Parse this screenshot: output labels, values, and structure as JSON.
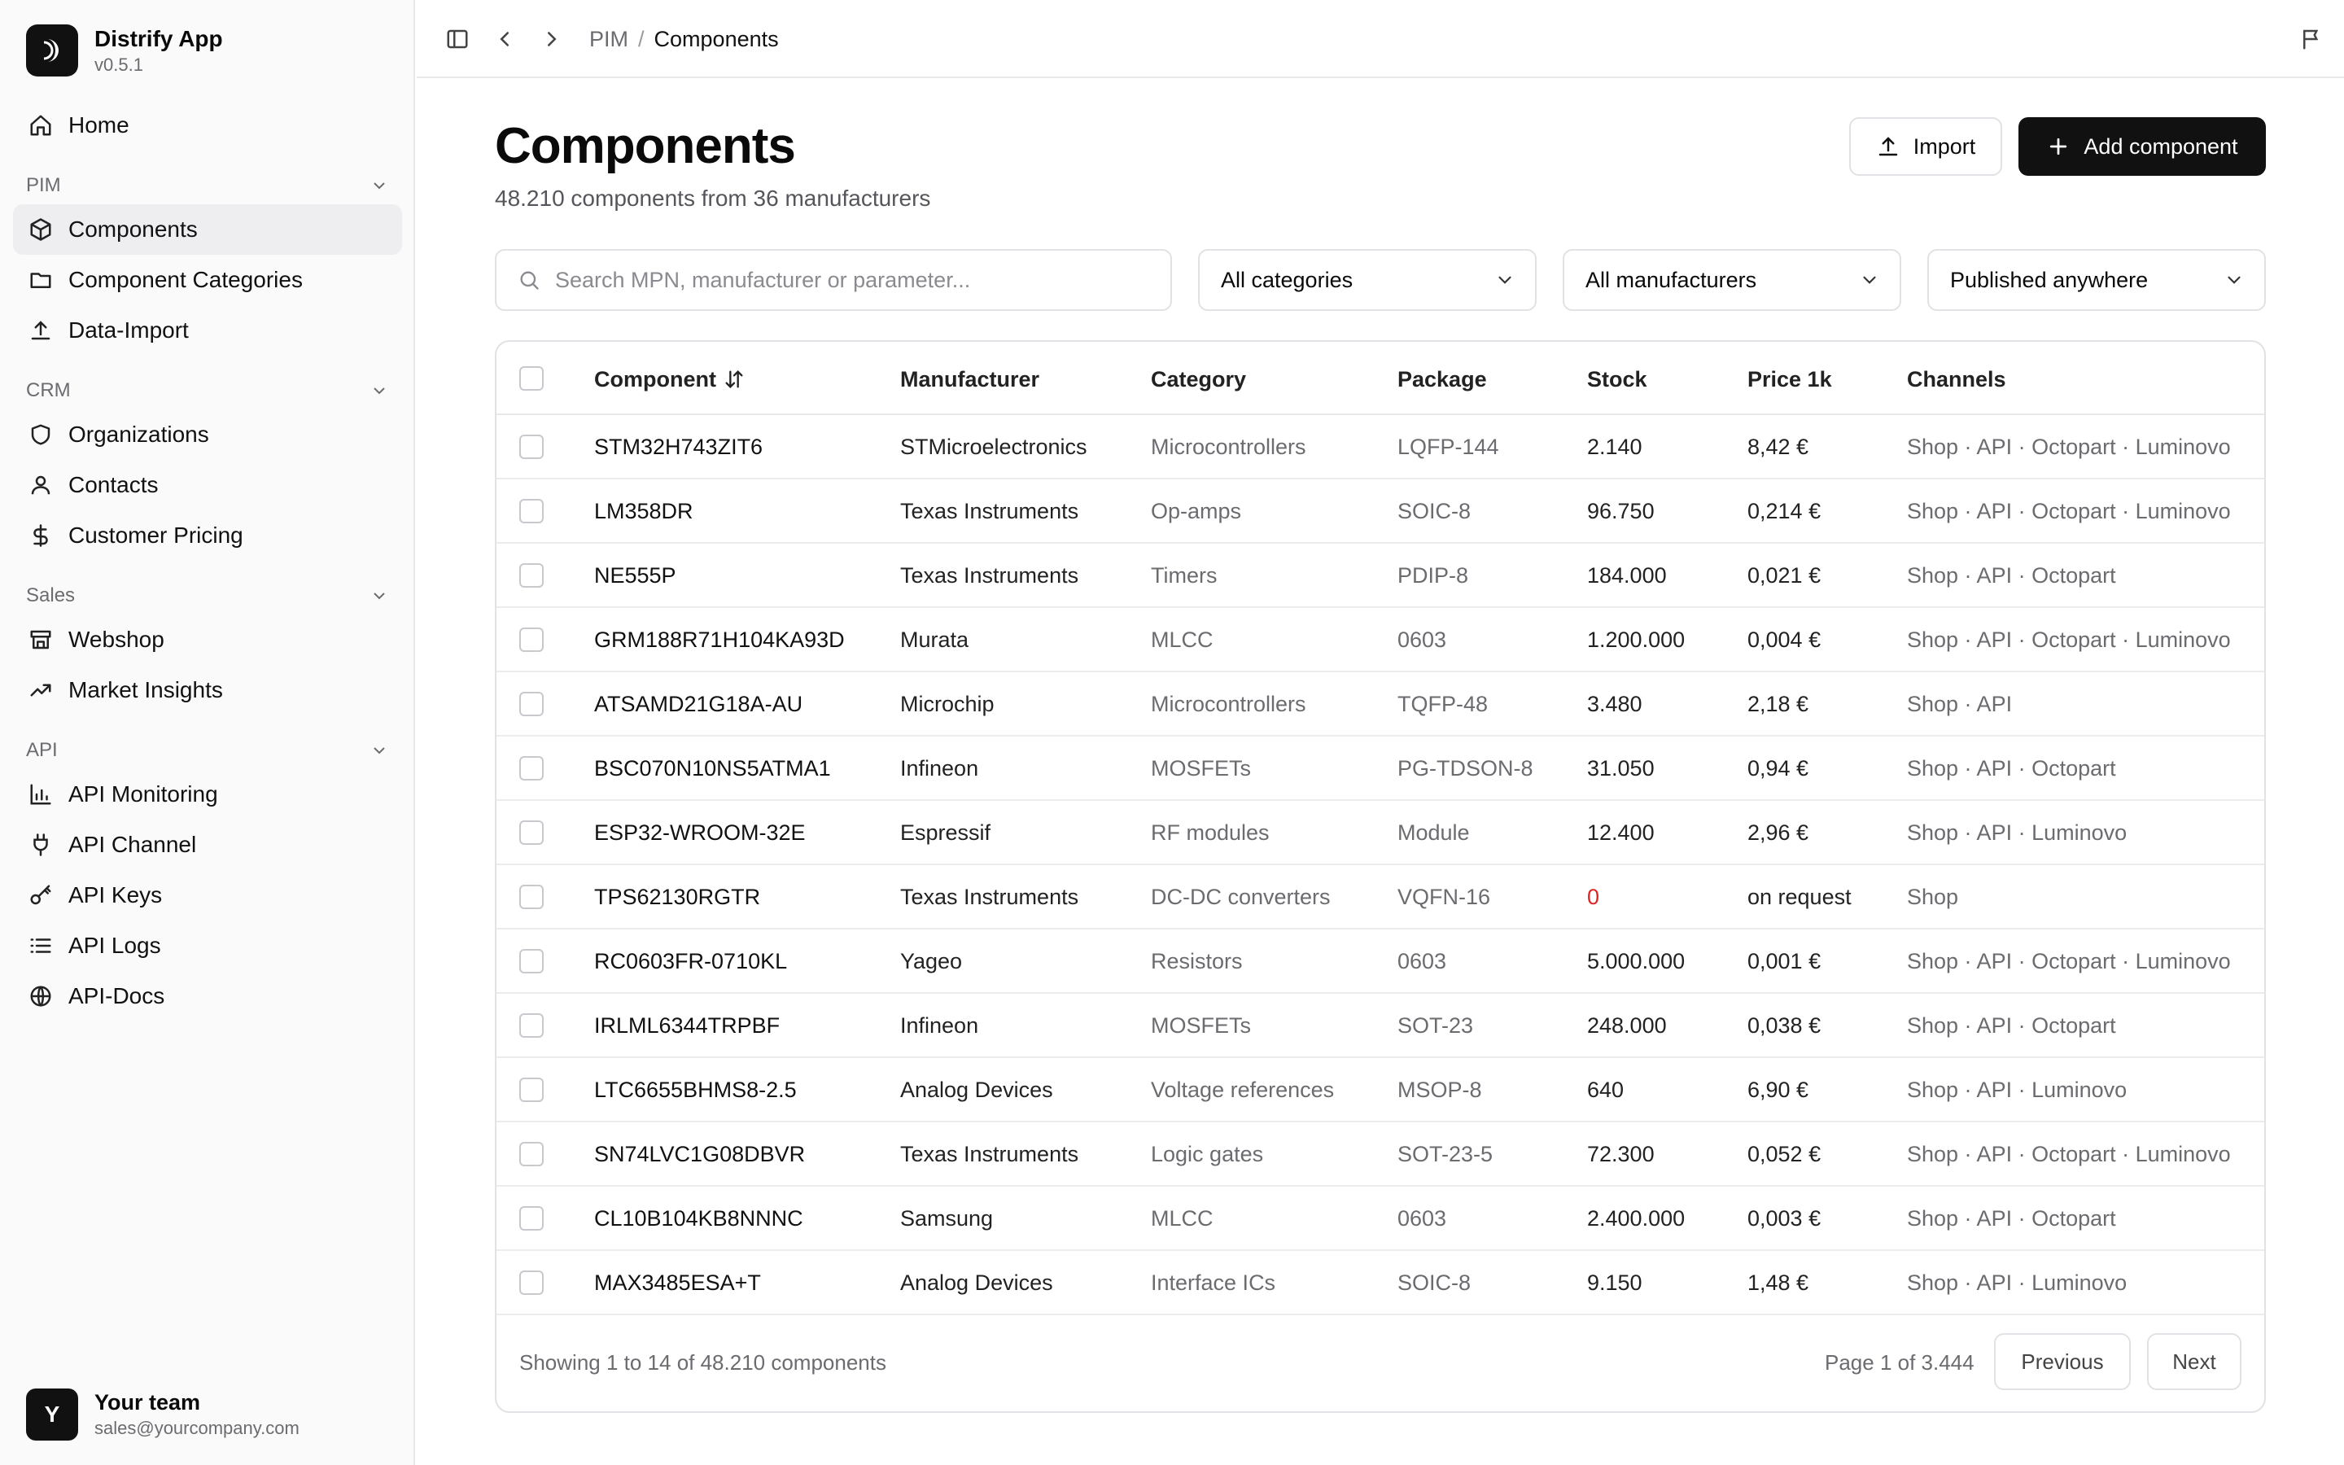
{
  "app": {
    "name": "Distrify App",
    "version": "v0.5.1"
  },
  "sidebar": {
    "home": "Home",
    "sections": [
      {
        "title": "PIM",
        "items": [
          "Components",
          "Component Categories",
          "Data-Import"
        ]
      },
      {
        "title": "CRM",
        "items": [
          "Organizations",
          "Contacts",
          "Customer Pricing"
        ]
      },
      {
        "title": "Sales",
        "items": [
          "Webshop",
          "Market Insights"
        ]
      },
      {
        "title": "API",
        "items": [
          "API Monitoring",
          "API Channel",
          "API Keys",
          "API Logs",
          "API-Docs"
        ]
      }
    ],
    "active_item": "Components",
    "user": {
      "initial": "Y",
      "name": "Your team",
      "email": "sales@yourcompany.com"
    }
  },
  "breadcrumb": {
    "parent": "PIM",
    "separator": "/",
    "current": "Components"
  },
  "header": {
    "title": "Components",
    "subtitle": "48.210 components from 36 manufacturers",
    "import_label": "Import",
    "add_label": "Add component"
  },
  "filters": {
    "search_placeholder": "Search MPN, manufacturer or parameter...",
    "category": "All categories",
    "manufacturer": "All manufacturers",
    "channel": "Published anywhere"
  },
  "table": {
    "columns": [
      "Component",
      "Manufacturer",
      "Category",
      "Package",
      "Stock",
      "Price 1k",
      "Channels"
    ],
    "rows": [
      [
        "STM32H743ZIT6",
        "STMicroelectronics",
        "Microcontrollers",
        "LQFP-144",
        "2.140",
        "8,42 €",
        "Shop · API · Octopart · Luminovo"
      ],
      [
        "LM358DR",
        "Texas Instruments",
        "Op-amps",
        "SOIC-8",
        "96.750",
        "0,214 €",
        "Shop · API · Octopart · Luminovo"
      ],
      [
        "NE555P",
        "Texas Instruments",
        "Timers",
        "PDIP-8",
        "184.000",
        "0,021 €",
        "Shop · API · Octopart"
      ],
      [
        "GRM188R71H104KA93D",
        "Murata",
        "MLCC",
        "0603",
        "1.200.000",
        "0,004 €",
        "Shop · API · Octopart · Luminovo"
      ],
      [
        "ATSAMD21G18A-AU",
        "Microchip",
        "Microcontrollers",
        "TQFP-48",
        "3.480",
        "2,18 €",
        "Shop · API"
      ],
      [
        "BSC070N10NS5ATMA1",
        "Infineon",
        "MOSFETs",
        "PG-TDSON-8",
        "31.050",
        "0,94 €",
        "Shop · API · Octopart"
      ],
      [
        "ESP32-WROOM-32E",
        "Espressif",
        "RF modules",
        "Module",
        "12.400",
        "2,96 €",
        "Shop · API · Luminovo"
      ],
      [
        "TPS62130RGTR",
        "Texas Instruments",
        "DC-DC converters",
        "VQFN-16",
        "0",
        "on request",
        "Shop"
      ],
      [
        "RC0603FR-0710KL",
        "Yageo",
        "Resistors",
        "0603",
        "5.000.000",
        "0,001 €",
        "Shop · API · Octopart · Luminovo"
      ],
      [
        "IRLML6344TRPBF",
        "Infineon",
        "MOSFETs",
        "SOT-23",
        "248.000",
        "0,038 €",
        "Shop · API · Octopart"
      ],
      [
        "LTC6655BHMS8-2.5",
        "Analog Devices",
        "Voltage references",
        "MSOP-8",
        "640",
        "6,90 €",
        "Shop · API · Luminovo"
      ],
      [
        "SN74LVC1G08DBVR",
        "Texas Instruments",
        "Logic gates",
        "SOT-23-5",
        "72.300",
        "0,052 €",
        "Shop · API · Octopart · Luminovo"
      ],
      [
        "CL10B104KB8NNNC",
        "Samsung",
        "MLCC",
        "0603",
        "2.400.000",
        "0,003 €",
        "Shop · API · Octopart"
      ],
      [
        "MAX3485ESA+T",
        "Analog Devices",
        "Interface ICs",
        "SOIC-8",
        "9.150",
        "1,48 €",
        "Shop · API · Luminovo"
      ]
    ],
    "out_of_stock_color": "#dc2626"
  },
  "footer": {
    "showing": "Showing 1 to 14 of 48.210 components",
    "page": "Page 1 of 3.444",
    "previous": "Previous",
    "next": "Next"
  },
  "icons": {
    "sidebar_toggle": "panel-left-icon",
    "back": "chevron-left-icon",
    "forward": "chevron-right-icon",
    "flag": "flag-icon",
    "sort": "sort-arrows-icon"
  }
}
